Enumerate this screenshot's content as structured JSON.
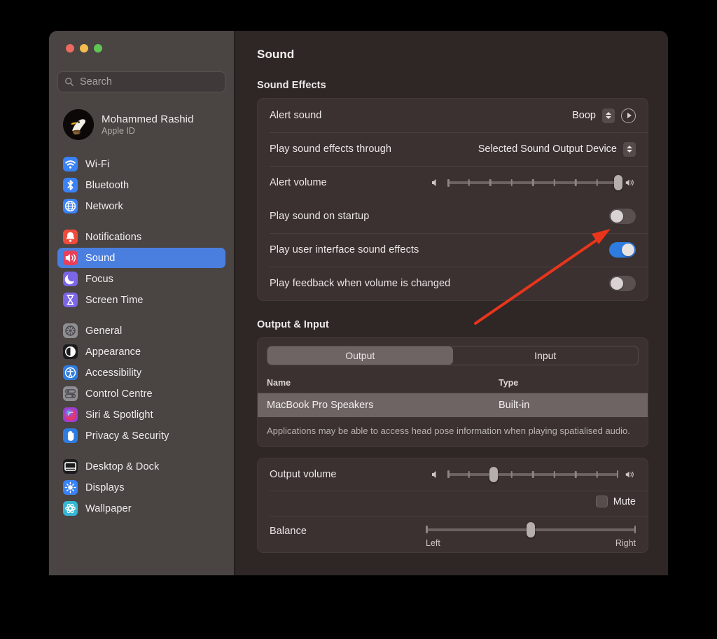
{
  "window": {
    "traffic_lights": [
      "close",
      "minimize",
      "zoom"
    ],
    "colors": {
      "accent": "#4a7fe0",
      "toggle_on": "#2f7ce0",
      "annotation": "#e8351b"
    }
  },
  "sidebar": {
    "search": {
      "placeholder": "Search",
      "value": ""
    },
    "profile": {
      "name": "Mohammed Rashid",
      "subtitle": "Apple ID",
      "avatar": "eagle-avatar"
    },
    "groups": [
      {
        "items": [
          {
            "label": "Wi-Fi",
            "icon": "wifi-icon",
            "color": "#3a82f6",
            "selected": false
          },
          {
            "label": "Bluetooth",
            "icon": "bluetooth-icon",
            "color": "#3a82f6",
            "selected": false
          },
          {
            "label": "Network",
            "icon": "globe-icon",
            "color": "#3a82f6",
            "selected": false
          }
        ]
      },
      {
        "items": [
          {
            "label": "Notifications",
            "icon": "bell-icon",
            "color": "#ef4b3c",
            "selected": false
          },
          {
            "label": "Sound",
            "icon": "speaker-icon",
            "color": "#e8405a",
            "selected": true
          },
          {
            "label": "Focus",
            "icon": "moon-icon",
            "color": "#7b66e8",
            "selected": false
          },
          {
            "label": "Screen Time",
            "icon": "hourglass-icon",
            "color": "#7b66e8",
            "selected": false
          }
        ]
      },
      {
        "items": [
          {
            "label": "General",
            "icon": "gear-icon",
            "color": "#8e8e93",
            "selected": false
          },
          {
            "label": "Appearance",
            "icon": "contrast-icon",
            "color": "#1c1c1e",
            "selected": false
          },
          {
            "label": "Accessibility",
            "icon": "accessibility-icon",
            "color": "#2f7ce0",
            "selected": false
          },
          {
            "label": "Control Centre",
            "icon": "control-centre-icon",
            "color": "#8e8e93",
            "selected": false
          },
          {
            "label": "Siri & Spotlight",
            "icon": "siri-icon",
            "color": "#9b3fd0",
            "selected": false
          },
          {
            "label": "Privacy & Security",
            "icon": "hand-icon",
            "color": "#2f7ce0",
            "selected": false
          }
        ]
      },
      {
        "items": [
          {
            "label": "Desktop & Dock",
            "icon": "desktop-dock-icon",
            "color": "#1c1c1e",
            "selected": false
          },
          {
            "label": "Displays",
            "icon": "brightness-icon",
            "color": "#3a82f6",
            "selected": false
          },
          {
            "label": "Wallpaper",
            "icon": "wallpaper-icon",
            "color": "#35b7d3",
            "selected": false
          }
        ]
      }
    ]
  },
  "main": {
    "title": "Sound",
    "sound_effects": {
      "heading": "Sound Effects",
      "alert_sound": {
        "label": "Alert sound",
        "value": "Boop",
        "play_button": "play-icon"
      },
      "play_through": {
        "label": "Play sound effects through",
        "value": "Selected Sound Output Device"
      },
      "alert_volume": {
        "label": "Alert volume",
        "value_percent": 100,
        "ticks": 7
      },
      "toggles": [
        {
          "label": "Play sound on startup",
          "on": false
        },
        {
          "label": "Play user interface sound effects",
          "on": true
        },
        {
          "label": "Play feedback when volume is changed",
          "on": false
        }
      ]
    },
    "output_input": {
      "heading": "Output & Input",
      "tabs": [
        {
          "label": "Output",
          "active": true
        },
        {
          "label": "Input",
          "active": false
        }
      ],
      "table": {
        "columns": [
          "Name",
          "Type"
        ],
        "rows": [
          {
            "name": "MacBook Pro Speakers",
            "type": "Built-in",
            "selected": true
          }
        ]
      },
      "note": "Applications may be able to access head pose information when playing spatialised audio."
    },
    "output_controls": {
      "output_volume": {
        "label": "Output volume",
        "value_percent": 27,
        "ticks": 7
      },
      "mute": {
        "label": "Mute",
        "checked": false
      },
      "balance": {
        "label": "Balance",
        "value_percent": 50,
        "left_label": "Left",
        "right_label": "Right"
      }
    }
  }
}
